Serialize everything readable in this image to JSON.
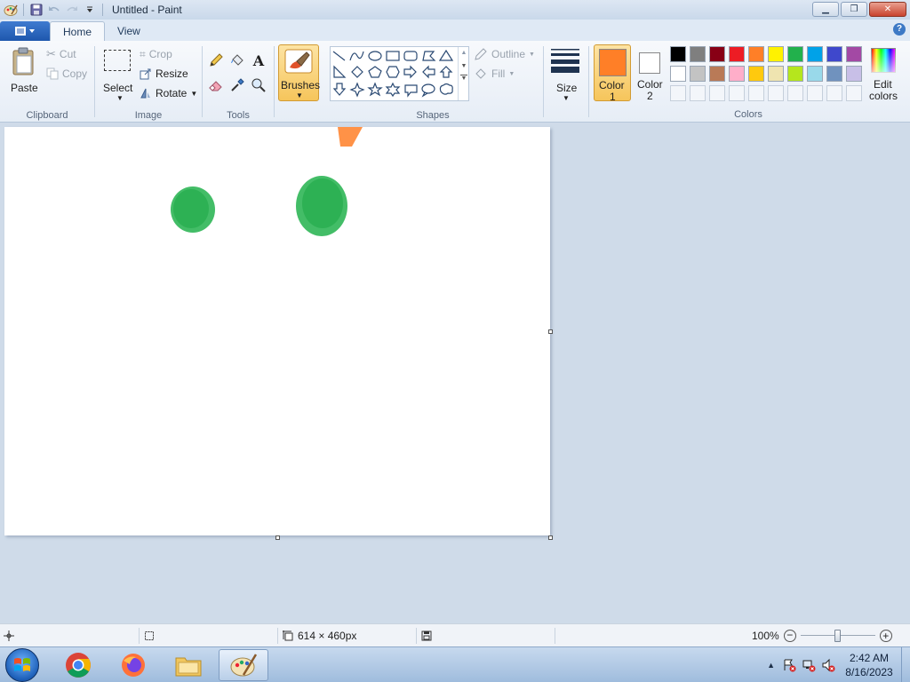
{
  "window": {
    "title": "Untitled - Paint"
  },
  "tabs": {
    "home": "Home",
    "view": "View"
  },
  "clipboard": {
    "paste": "Paste",
    "cut": "Cut",
    "copy": "Copy",
    "label": "Clipboard"
  },
  "image": {
    "select": "Select",
    "crop": "Crop",
    "resize": "Resize",
    "rotate": "Rotate",
    "label": "Image"
  },
  "tools": {
    "label": "Tools"
  },
  "brushes": {
    "label": "Brushes"
  },
  "shapes": {
    "outline": "Outline",
    "fill": "Fill",
    "label": "Shapes"
  },
  "size": {
    "label": "Size"
  },
  "colors": {
    "color1_line1": "Color",
    "color1_line2": "1",
    "color2_line1": "Color",
    "color2_line2": "2",
    "edit_line1": "Edit",
    "edit_line2": "colors",
    "label": "Colors",
    "color1_value": "#ff7f27",
    "color2_value": "#ffffff",
    "palette_row1": [
      "#000000",
      "#7f7f7f",
      "#880015",
      "#ed1c24",
      "#ff7f27",
      "#fff200",
      "#22b14c",
      "#00a2e8",
      "#3f48cc",
      "#a349a4"
    ],
    "palette_row2": [
      "#ffffff",
      "#c3c3c3",
      "#b97a57",
      "#ffaec9",
      "#ffc90e",
      "#efe4b0",
      "#b5e61d",
      "#99d9ea",
      "#7092be",
      "#c8bfe7"
    ]
  },
  "status": {
    "canvas_size": "614 × 460px",
    "zoom": "100%"
  },
  "taskbar": {
    "time": "2:42 AM",
    "date": "8/16/2023"
  }
}
